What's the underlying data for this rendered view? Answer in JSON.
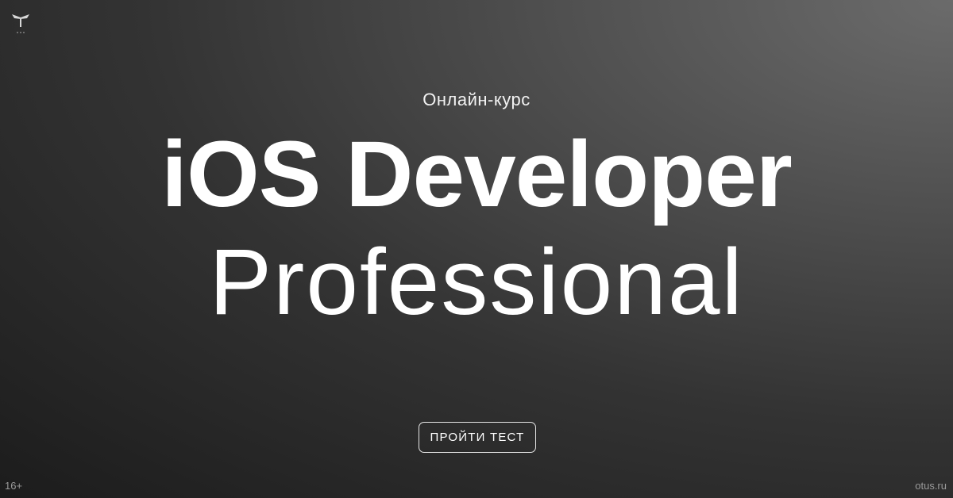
{
  "brand": {
    "logo_icon": "otus-owl-logo-icon",
    "site": "otus.ru"
  },
  "header": {
    "subtitle": "Онлайн-курс"
  },
  "hero": {
    "title": "iOS Developer",
    "subtitle": "Professional"
  },
  "cta": {
    "label": "ПРОЙТИ ТЕСТ"
  },
  "footer": {
    "age_rating": "16+"
  },
  "colors": {
    "background_light": "#6b6b6b",
    "background_dark": "#1c1c1c",
    "text": "#ffffff",
    "muted_text": "#9a9a9a"
  }
}
